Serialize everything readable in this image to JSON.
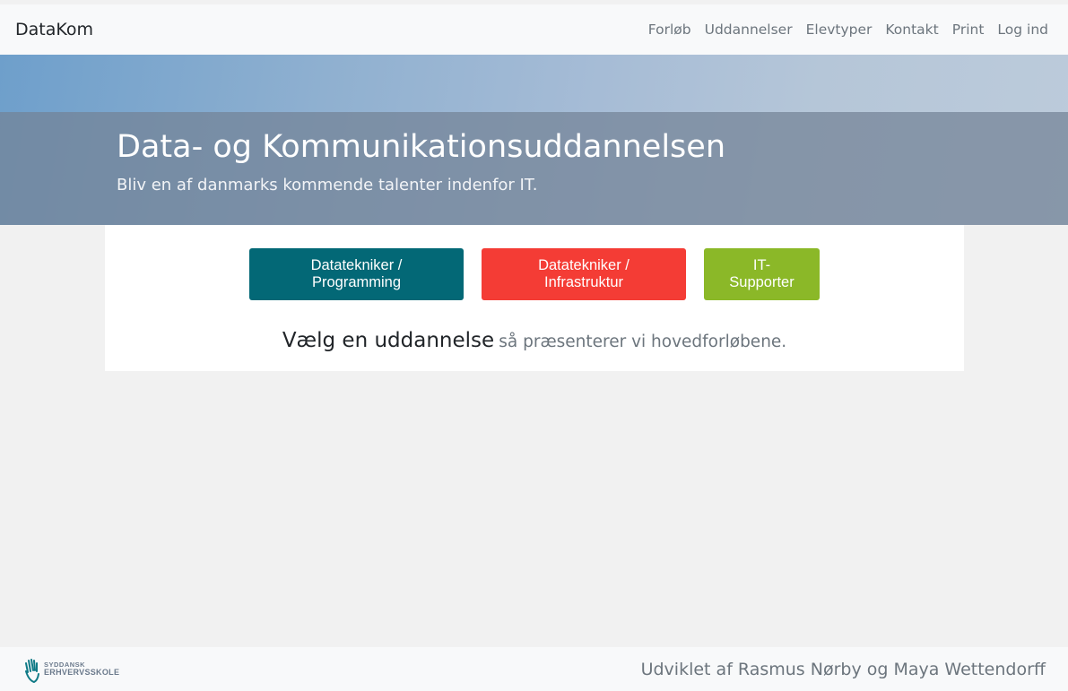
{
  "navbar": {
    "brand": "DataKom",
    "links": [
      "Forløb",
      "Uddannelser",
      "Elevtyper",
      "Kontakt",
      "Print",
      "Log ind"
    ]
  },
  "hero": {
    "title": "Data- og Kommunikationsuddannelsen",
    "subtitle": "Bliv en af danmarks kommende talenter indenfor IT."
  },
  "main": {
    "buttons": [
      {
        "label": "Datatekniker / Programming",
        "color": "#036876"
      },
      {
        "label": "Datatekniker / Infrastruktur",
        "color": "#f43c35"
      },
      {
        "label": "IT-Supporter",
        "color": "#8bb828"
      }
    ],
    "prompt_main": "Vælg en uddannelse",
    "prompt_rest": "så præsenterer vi hovedforløbene."
  },
  "footer": {
    "logo_line1": "SYDDANSK",
    "logo_line2": "ERHVERVSSKOLE",
    "logo_icon": "hand-logo-icon",
    "credit": "Udviklet af Rasmus Nørby og Maya Wettendorff"
  }
}
